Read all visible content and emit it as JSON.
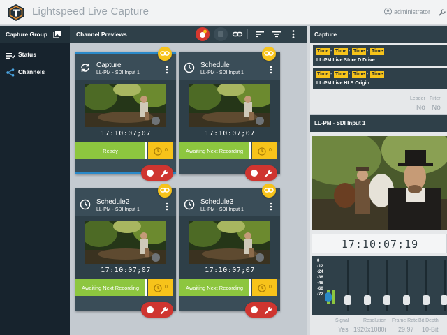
{
  "app": {
    "title": "Lightspeed Live Capture",
    "user": "administrator"
  },
  "colors": {
    "accent_blue": "#2a89c9",
    "ready_green": "#8dc63f",
    "schedule_yellow": "#f7c31a",
    "record_red": "#cf3530",
    "sidebar": "#17232d"
  },
  "sidebar": {
    "header": "Capture Group",
    "header_icon": "gallery-icon",
    "items": [
      {
        "label": "Status",
        "icon": "list-icon"
      },
      {
        "label": "Channels",
        "icon": "share-icon"
      }
    ]
  },
  "center": {
    "title": "Channel Previews",
    "toolbar_icons": [
      "record-all-icon",
      "stop-all-icon",
      "link-icon",
      "sort-icon",
      "filter-icon",
      "more-vert-icon"
    ]
  },
  "channels": [
    {
      "name": "Capture",
      "input": "LL-PM - SDI Input 1",
      "timecode": "17:10:07;07",
      "status": "Ready",
      "schedule_count": "0",
      "icon": "sync-icon"
    },
    {
      "name": "Schedule",
      "input": "LL-PM - SDI Input 1",
      "timecode": "17:10:07;07",
      "status": "Awaiting Next Recording",
      "schedule_count": "0",
      "icon": "clock-icon"
    },
    {
      "name": "Schedule2",
      "input": "LL-PM - SDI Input 1",
      "timecode": "17:10:07;07",
      "status": "Awaiting Next Recording",
      "schedule_count": "0",
      "icon": "clock-icon"
    },
    {
      "name": "Schedule3",
      "input": "LL-PM - SDI Input 1",
      "timecode": "17:10:07;07",
      "status": "Awaiting Next Recording",
      "schedule_count": "0",
      "icon": "clock-icon"
    }
  ],
  "capture_panel": {
    "title": "Capture",
    "destinations": [
      {
        "chips": [
          "Time",
          "Time",
          "Time",
          "Time"
        ],
        "name": "LL-PM Live Store D Drive"
      },
      {
        "chips": [
          "Time",
          "Time",
          "Time",
          "Time"
        ],
        "name": "LL-PM Live HLS Origin"
      }
    ],
    "stats": [
      {
        "label": "Leader",
        "value": "No"
      },
      {
        "label": "Filter",
        "value": "No"
      }
    ]
  },
  "input_panel": {
    "title": "LL-PM - SDI Input 1",
    "timecode": "17:10:07;19",
    "meter_labels": [
      "0",
      "-12",
      "-24",
      "-36",
      "-48",
      "-60",
      "-72"
    ],
    "meter_levels": [
      0.3,
      0.3
    ],
    "info": [
      {
        "label": "Signal",
        "value": "Yes"
      },
      {
        "label": "Resolution",
        "value": "1920x1080i"
      },
      {
        "label": "Frame Rate",
        "value": "29.97"
      },
      {
        "label": "Bit Depth",
        "value": "10-Bit"
      }
    ]
  }
}
